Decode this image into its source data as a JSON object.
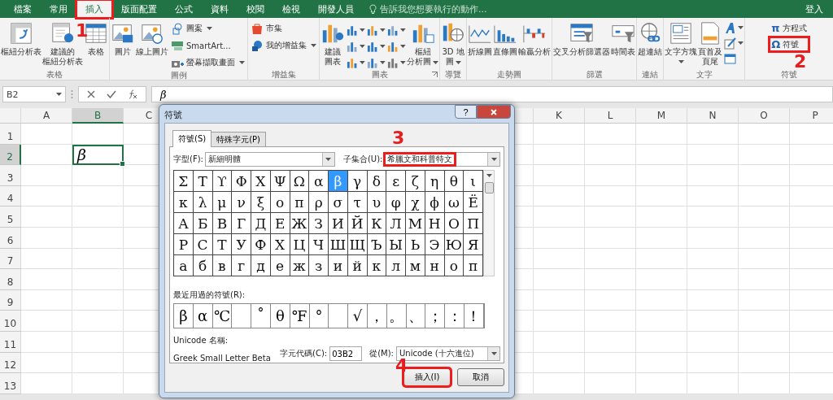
{
  "tabs": [
    {
      "label": "檔案",
      "selected": false,
      "highlighted": false
    },
    {
      "label": "常用",
      "selected": false,
      "highlighted": false
    },
    {
      "label": "插入",
      "selected": true,
      "highlighted": true
    },
    {
      "label": "版面配置",
      "selected": false,
      "highlighted": false
    },
    {
      "label": "公式",
      "selected": false,
      "highlighted": false
    },
    {
      "label": "資料",
      "selected": false,
      "highlighted": false
    },
    {
      "label": "校閱",
      "selected": false,
      "highlighted": false
    },
    {
      "label": "檢視",
      "selected": false,
      "highlighted": false
    },
    {
      "label": "開發人員",
      "selected": false,
      "highlighted": false
    }
  ],
  "tell_me": {
    "placeholder": "告訴我您想要執行的動作..."
  },
  "sign_in": "登入",
  "ribbon_groups": [
    {
      "label": "表格",
      "items": [
        {
          "kind": "large",
          "lines": [
            "樞紐分析表"
          ]
        },
        {
          "kind": "large",
          "lines": [
            "建議的",
            "樞紐分析表"
          ]
        },
        {
          "kind": "large",
          "lines": [
            "表格"
          ]
        }
      ]
    },
    {
      "label": "圖例",
      "items": [
        {
          "kind": "large",
          "lines": [
            "圖片"
          ]
        },
        {
          "kind": "large",
          "lines": [
            "線上圖片"
          ]
        },
        {
          "kind": "stack",
          "buttons": [
            {
              "label": "圖案",
              "menu": true
            },
            {
              "label": "SmartArt...",
              "menu": false
            },
            {
              "label": "螢幕擷取畫面",
              "menu": true
            }
          ]
        }
      ]
    },
    {
      "label": "增益集",
      "items": [
        {
          "kind": "stack",
          "buttons": [
            {
              "label": "市集",
              "menu": false
            },
            {
              "label": "我的增益集",
              "menu": true
            }
          ]
        }
      ]
    },
    {
      "label": "圖表",
      "launcher": true,
      "items": [
        {
          "kind": "large",
          "lines": [
            "建議",
            "圖表"
          ]
        },
        {
          "kind": "gallery"
        },
        {
          "kind": "large",
          "lines": [
            "樞紐",
            "分析圖"
          ],
          "menu": true
        }
      ]
    },
    {
      "label": "導覽",
      "items": [
        {
          "kind": "large",
          "lines": [
            "3D 地",
            "圖"
          ],
          "menu": true
        }
      ]
    },
    {
      "label": "走勢圖",
      "items": [
        {
          "kind": "large",
          "lines": [
            "折線圖"
          ]
        },
        {
          "kind": "large",
          "lines": [
            "直條圖"
          ]
        },
        {
          "kind": "large",
          "lines": [
            "輸贏分析"
          ]
        }
      ]
    },
    {
      "label": "篩選",
      "items": [
        {
          "kind": "large",
          "lines": [
            "交叉分析篩選器"
          ]
        },
        {
          "kind": "large",
          "lines": [
            "時間表"
          ]
        }
      ]
    },
    {
      "label": "連結",
      "items": [
        {
          "kind": "large",
          "lines": [
            "超連結"
          ]
        }
      ]
    },
    {
      "label": "文字",
      "items": [
        {
          "kind": "large",
          "lines": [
            "文字方塊"
          ],
          "menu": true
        },
        {
          "kind": "large",
          "lines": [
            "頁首及",
            "頁尾"
          ]
        },
        {
          "kind": "icons",
          "buttons": [
            {
              "menu": true
            },
            {
              "menu": true
            },
            {
              "menu": false
            }
          ]
        }
      ]
    },
    {
      "label": "符號",
      "items": [
        {
          "kind": "stack",
          "buttons": [
            {
              "glyph": "π",
              "label": "方程式",
              "menu": false
            },
            {
              "glyph": "Ω",
              "label": "符號",
              "menu": false,
              "highlighted": true
            }
          ]
        }
      ]
    }
  ],
  "formula_bar": {
    "name_box": "B2",
    "formula": "β"
  },
  "sheet": {
    "columns": [
      {
        "label": "A",
        "selected": false
      },
      {
        "label": "B",
        "selected": true
      },
      {
        "label": "C",
        "selected": false
      },
      {
        "label": "K",
        "selected": false
      },
      {
        "label": "L",
        "selected": false
      },
      {
        "label": "M",
        "selected": false
      },
      {
        "label": "N",
        "selected": false
      },
      {
        "label": "O",
        "selected": false
      },
      {
        "label": "P",
        "selected": false
      }
    ],
    "rows": [
      {
        "label": "1",
        "selected": false
      },
      {
        "label": "2",
        "selected": true
      },
      {
        "label": "3",
        "selected": false
      },
      {
        "label": "4",
        "selected": false
      },
      {
        "label": "5",
        "selected": false
      },
      {
        "label": "6",
        "selected": false
      },
      {
        "label": "7",
        "selected": false
      },
      {
        "label": "8",
        "selected": false
      },
      {
        "label": "9",
        "selected": false
      },
      {
        "label": "10",
        "selected": false
      },
      {
        "label": "11",
        "selected": false
      },
      {
        "label": "12",
        "selected": false
      },
      {
        "label": "13",
        "selected": false
      }
    ],
    "active_cell": {
      "value": "β"
    }
  },
  "dialog": {
    "title": "符號",
    "help": "?",
    "tabs": [
      {
        "label": "符號(S)",
        "selected": true
      },
      {
        "label": "特殊字元(P)",
        "selected": false
      }
    ],
    "font_label": "字型(F):",
    "font": "新細明體",
    "subset_label": "子集合(U):",
    "subset": "希臘文和科普特文",
    "subset_highlighted": true,
    "symbols": [
      [
        {
          "c": "Σ",
          "selected": false
        },
        {
          "c": "Τ",
          "selected": false
        },
        {
          "c": "ϒ",
          "selected": false
        },
        {
          "c": "Φ",
          "selected": false
        },
        {
          "c": "Χ",
          "selected": false
        },
        {
          "c": "Ψ",
          "selected": false
        },
        {
          "c": "Ω",
          "selected": false
        },
        {
          "c": "α",
          "selected": false
        },
        {
          "c": "β",
          "selected": true
        },
        {
          "c": "γ",
          "selected": false
        },
        {
          "c": "δ",
          "selected": false
        },
        {
          "c": "ε",
          "selected": false
        },
        {
          "c": "ζ",
          "selected": false
        },
        {
          "c": "η",
          "selected": false
        },
        {
          "c": "θ",
          "selected": false
        },
        {
          "c": "ι",
          "selected": false
        }
      ],
      [
        {
          "c": "κ",
          "selected": false
        },
        {
          "c": "λ",
          "selected": false
        },
        {
          "c": "μ",
          "selected": false
        },
        {
          "c": "ν",
          "selected": false
        },
        {
          "c": "ξ",
          "selected": false
        },
        {
          "c": "ο",
          "selected": false
        },
        {
          "c": "π",
          "selected": false
        },
        {
          "c": "ρ",
          "selected": false
        },
        {
          "c": "σ",
          "selected": false
        },
        {
          "c": "τ",
          "selected": false
        },
        {
          "c": "υ",
          "selected": false
        },
        {
          "c": "φ",
          "selected": false
        },
        {
          "c": "χ",
          "selected": false
        },
        {
          "c": "ϕ",
          "selected": false
        },
        {
          "c": "ω",
          "selected": false
        },
        {
          "c": "Ё",
          "selected": false
        }
      ],
      [
        {
          "c": "А",
          "selected": false
        },
        {
          "c": "Б",
          "selected": false
        },
        {
          "c": "В",
          "selected": false
        },
        {
          "c": "Г",
          "selected": false
        },
        {
          "c": "Д",
          "selected": false
        },
        {
          "c": "Е",
          "selected": false
        },
        {
          "c": "Ж",
          "selected": false
        },
        {
          "c": "З",
          "selected": false
        },
        {
          "c": "И",
          "selected": false
        },
        {
          "c": "Й",
          "selected": false
        },
        {
          "c": "К",
          "selected": false
        },
        {
          "c": "Л",
          "selected": false
        },
        {
          "c": "М",
          "selected": false
        },
        {
          "c": "Н",
          "selected": false
        },
        {
          "c": "О",
          "selected": false
        },
        {
          "c": "П",
          "selected": false
        }
      ],
      [
        {
          "c": "Р",
          "selected": false
        },
        {
          "c": "С",
          "selected": false
        },
        {
          "c": "Т",
          "selected": false
        },
        {
          "c": "У",
          "selected": false
        },
        {
          "c": "Ф",
          "selected": false
        },
        {
          "c": "Х",
          "selected": false
        },
        {
          "c": "Ц",
          "selected": false
        },
        {
          "c": "Ч",
          "selected": false
        },
        {
          "c": "Ш",
          "selected": false
        },
        {
          "c": "Щ",
          "selected": false
        },
        {
          "c": "Ъ",
          "selected": false
        },
        {
          "c": "Ы",
          "selected": false
        },
        {
          "c": "Ь",
          "selected": false
        },
        {
          "c": "Э",
          "selected": false
        },
        {
          "c": "Ю",
          "selected": false
        },
        {
          "c": "Я",
          "selected": false
        }
      ],
      [
        {
          "c": "а",
          "selected": false
        },
        {
          "c": "б",
          "selected": false
        },
        {
          "c": "в",
          "selected": false
        },
        {
          "c": "г",
          "selected": false
        },
        {
          "c": "д",
          "selected": false
        },
        {
          "c": "е",
          "selected": false
        },
        {
          "c": "ж",
          "selected": false
        },
        {
          "c": "з",
          "selected": false
        },
        {
          "c": "и",
          "selected": false
        },
        {
          "c": "й",
          "selected": false
        },
        {
          "c": "к",
          "selected": false
        },
        {
          "c": "л",
          "selected": false
        },
        {
          "c": "м",
          "selected": false
        },
        {
          "c": "н",
          "selected": false
        },
        {
          "c": "о",
          "selected": false
        },
        {
          "c": "п",
          "selected": false
        }
      ]
    ],
    "recent_label": "最近用過的符號(R):",
    "recent": [
      {
        "kind": "symbol",
        "c": "β"
      },
      {
        "kind": "symbol",
        "c": "α"
      },
      {
        "kind": "symbol",
        "c": "℃"
      },
      {
        "kind": "blank"
      },
      {
        "kind": "symbol",
        "c": "˚"
      },
      {
        "kind": "symbol",
        "c": "θ"
      },
      {
        "kind": "symbol",
        "c": "℉"
      },
      {
        "kind": "symbol",
        "c": "°"
      },
      {
        "kind": "blank"
      },
      {
        "kind": "symbol",
        "c": "√"
      },
      {
        "kind": "symbol",
        "c": "，"
      },
      {
        "kind": "symbol",
        "c": "。"
      },
      {
        "kind": "symbol",
        "c": "、"
      },
      {
        "kind": "symbol",
        "c": "；"
      },
      {
        "kind": "symbol",
        "c": "："
      },
      {
        "kind": "symbol",
        "c": "！"
      }
    ],
    "unicode_name_label": "Unicode 名稱:",
    "unicode_name": "Greek Small Letter Beta",
    "char_code_label": "字元代碼(C):",
    "char_code": "03B2",
    "from_label": "從(M):",
    "from": "Unicode (十六進位)",
    "buttons": [
      {
        "label": "插入(I)",
        "highlighted": true
      },
      {
        "label": "取消",
        "highlighted": false
      }
    ]
  },
  "steps": [
    {
      "label": "1"
    },
    {
      "label": "2"
    },
    {
      "label": "3"
    },
    {
      "label": "4"
    }
  ]
}
